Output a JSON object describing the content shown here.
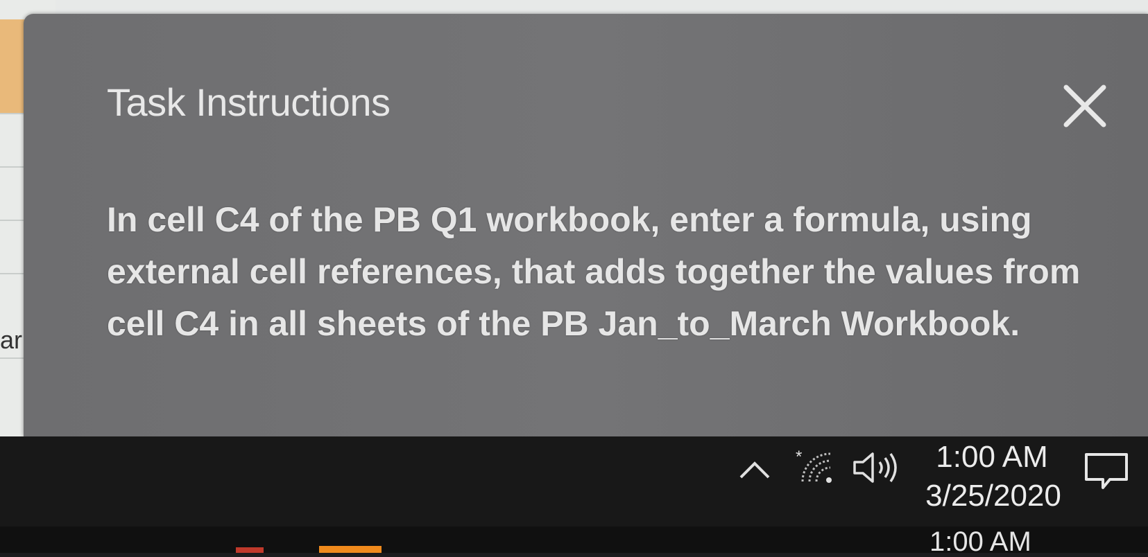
{
  "dialog": {
    "title": "Task Instructions",
    "body": "In cell C4 of the PB Q1 workbook, enter a formula, using external cell references, that adds together the values from cell C4 in all sheets of the PB Jan_to_March Workbook.",
    "close_icon": "close-icon"
  },
  "background_sheet": {
    "partial_label": "ar"
  },
  "taskbar": {
    "time": "1:00 AM",
    "date": "3/25/2020",
    "icons": [
      "chevron-up-icon",
      "wifi-icon",
      "volume-icon",
      "action-center-icon"
    ]
  },
  "taskbar_secondary": {
    "time": "1:00 AM"
  },
  "colors": {
    "dialog_bg": "#707072",
    "taskbar_bg": "#181818",
    "text": "#e6e6e6"
  }
}
